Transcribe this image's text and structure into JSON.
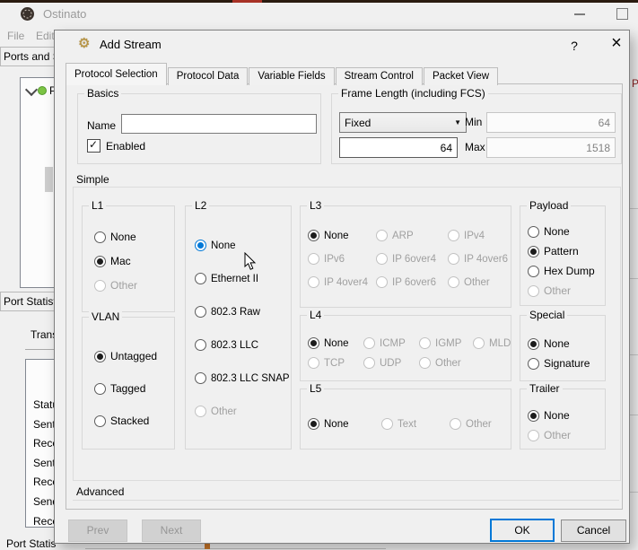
{
  "colors": {
    "accent": "#0078d7",
    "selected_dot": "#1c1c1c",
    "disabled_text": "#a0a0a0",
    "status_green": "#7cc444",
    "dialog_bg": "#f0f0f0"
  },
  "main_window": {
    "title": "Ostinato",
    "menus": [
      "File",
      "Edit"
    ],
    "ports_panel_title": "Ports and S",
    "tree_item_label": "P",
    "stats_panel_title": "Port Statist",
    "transmit_label": "Transmit",
    "stats_rows": [
      "Status",
      "Sent Fram",
      "Received",
      "Sent Byte",
      "Received",
      "Send Fram",
      "Receive"
    ],
    "bottom_panel_title": "Port Statis",
    "right_edge_fragment": "P"
  },
  "dialog": {
    "title": "Add Stream",
    "help_label": "?",
    "close_label": "×",
    "tabs": [
      {
        "label": "Protocol Selection",
        "active": true
      },
      {
        "label": "Protocol Data",
        "active": false
      },
      {
        "label": "Variable Fields",
        "active": false
      },
      {
        "label": "Stream Control",
        "active": false
      },
      {
        "label": "Packet View",
        "active": false
      }
    ],
    "basics": {
      "title": "Basics",
      "name_label": "Name",
      "name_value": "",
      "enabled_label": "Enabled",
      "enabled_checked": true
    },
    "frame_length": {
      "title": "Frame Length (including FCS)",
      "mode_value": "Fixed",
      "length_value": "64",
      "min_label": "Min",
      "min_value": "64",
      "max_label": "Max",
      "max_value": "1518"
    },
    "simple": {
      "title": "Simple",
      "groups": [
        {
          "id": "l1",
          "title": "L1",
          "items": [
            {
              "label": "None",
              "state": "normal"
            },
            {
              "label": "Mac",
              "state": "selected"
            },
            {
              "label": "Other",
              "state": "disabled"
            }
          ]
        },
        {
          "id": "vlan",
          "title": "VLAN",
          "items": [
            {
              "label": "Untagged",
              "state": "selected"
            },
            {
              "label": "Tagged",
              "state": "normal"
            },
            {
              "label": "Stacked",
              "state": "normal"
            }
          ]
        },
        {
          "id": "l2",
          "title": "L2",
          "items": [
            {
              "label": "None",
              "state": "hover-selected"
            },
            {
              "label": "Ethernet II",
              "state": "normal"
            },
            {
              "label": "802.3 Raw",
              "state": "normal"
            },
            {
              "label": "802.3 LLC",
              "state": "normal"
            },
            {
              "label": "802.3 LLC SNAP",
              "state": "normal"
            },
            {
              "label": "Other",
              "state": "disabled"
            }
          ]
        },
        {
          "id": "l3",
          "title": "L3",
          "items": [
            {
              "label": "None",
              "state": "selected"
            },
            {
              "label": "ARP",
              "state": "disabled"
            },
            {
              "label": "IPv4",
              "state": "disabled"
            },
            {
              "label": "IPv6",
              "state": "disabled"
            },
            {
              "label": "IP 6over4",
              "state": "disabled"
            },
            {
              "label": "IP 4over6",
              "state": "disabled"
            },
            {
              "label": "IP 4over4",
              "state": "disabled"
            },
            {
              "label": "IP 6over6",
              "state": "disabled"
            },
            {
              "label": "Other",
              "state": "disabled"
            }
          ]
        },
        {
          "id": "l4",
          "title": "L4",
          "items": [
            {
              "label": "None",
              "state": "selected"
            },
            {
              "label": "ICMP",
              "state": "disabled"
            },
            {
              "label": "IGMP",
              "state": "disabled"
            },
            {
              "label": "MLD",
              "state": "disabled"
            },
            {
              "label": "TCP",
              "state": "disabled"
            },
            {
              "label": "UDP",
              "state": "disabled"
            },
            {
              "label": "Other",
              "state": "disabled"
            }
          ]
        },
        {
          "id": "l5",
          "title": "L5",
          "items": [
            {
              "label": "None",
              "state": "selected"
            },
            {
              "label": "Text",
              "state": "disabled"
            },
            {
              "label": "Other",
              "state": "disabled"
            }
          ]
        },
        {
          "id": "payload",
          "title": "Payload",
          "items": [
            {
              "label": "None",
              "state": "normal"
            },
            {
              "label": "Pattern",
              "state": "selected"
            },
            {
              "label": "Hex Dump",
              "state": "normal"
            },
            {
              "label": "Other",
              "state": "disabled"
            }
          ]
        },
        {
          "id": "special",
          "title": "Special",
          "items": [
            {
              "label": "None",
              "state": "selected"
            },
            {
              "label": "Signature",
              "state": "normal"
            }
          ]
        },
        {
          "id": "trailer",
          "title": "Trailer",
          "items": [
            {
              "label": "None",
              "state": "selected"
            },
            {
              "label": "Other",
              "state": "disabled"
            }
          ]
        }
      ]
    },
    "advanced_title": "Advanced",
    "buttons": {
      "prev": "Prev",
      "next": "Next",
      "ok": "OK",
      "cancel": "Cancel"
    }
  }
}
